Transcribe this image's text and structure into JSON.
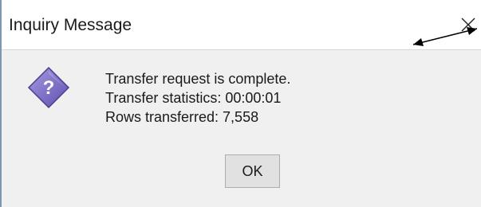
{
  "dialog": {
    "title": "Inquiry Message",
    "message_lines": [
      "Transfer request is complete.",
      "Transfer statistics: 00:00:01",
      "Rows transferred: 7,558"
    ],
    "ok_label": "OK"
  },
  "icons": {
    "close": "close-icon",
    "question": "question-icon",
    "annotation_arrow": "arrow-icon"
  },
  "colors": {
    "icon_purple": "#7b6fc4",
    "title_bg": "#ffffff",
    "body_bg": "#f0f0f0",
    "button_bg": "#e1e1e1"
  }
}
